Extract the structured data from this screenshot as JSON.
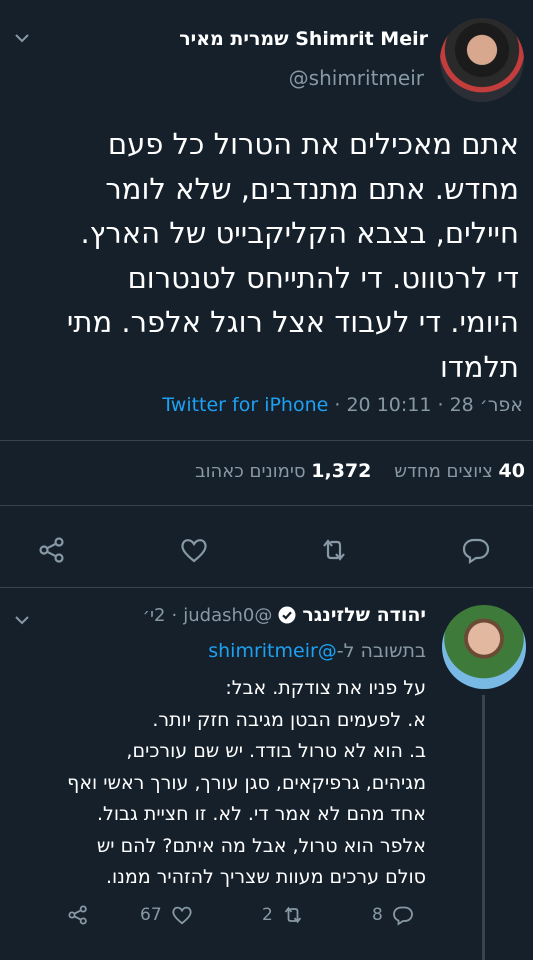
{
  "main_tweet": {
    "author_name": "שמרית מאיר Shimrit Meir",
    "handle": "@shimritmeir",
    "text_lines": [
      "אתם מאכילים את הטרול כל פעם",
      "מחדש. אתם מתנדבים, שלא לומר",
      "חיילים, בצבא הקליקבייט של הארץ.",
      "די לרטווט. די להתייחס לטנטרום",
      "היומי. די לעבוד אצל רוגל אלפר. מתי",
      "תלמדו"
    ],
    "source": "Twitter for iPhone",
    "date_time": " · 20 אפר׳ 28 · 10:11"
  },
  "stats": {
    "retweets_count": "40",
    "retweets_label": "ציוצים מחדש",
    "likes_count": "1,372",
    "likes_label": "סימונים כאהוב"
  },
  "actions": {
    "reply": "reply-icon",
    "retweet": "retweet-icon",
    "like": "heart-icon",
    "share": "share-icon"
  },
  "reply_tweet": {
    "author_name": "יהודה שלזינגר",
    "handle": "@judash0",
    "age": "2י׳",
    "reply_to_prefix": "בתשובה ל-",
    "reply_to_handle": "@shimritmeir",
    "text_lines": [
      "על פניו את צודקת. אבל:",
      "א. לפעמים הבטן מגיבה חזק יותר.",
      "ב. הוא לא טרול בודד. יש שם עורכים,",
      "מגיהים, גרפיקאים, סגן עורך, עורך ראשי ואף",
      "אחד מהם לא אמר די. לא. זו חציית גבול.",
      "אלפר הוא טרול, אבל מה איתם? להם יש",
      "סולם ערכים מעוות שצריך להזהיר ממנו."
    ],
    "reply_count": "8",
    "retweet_count": "2",
    "like_count": "67"
  },
  "colors": {
    "background": "#15202b",
    "accent": "#1da1f2",
    "muted": "#8899a6",
    "divider": "#38444d"
  }
}
